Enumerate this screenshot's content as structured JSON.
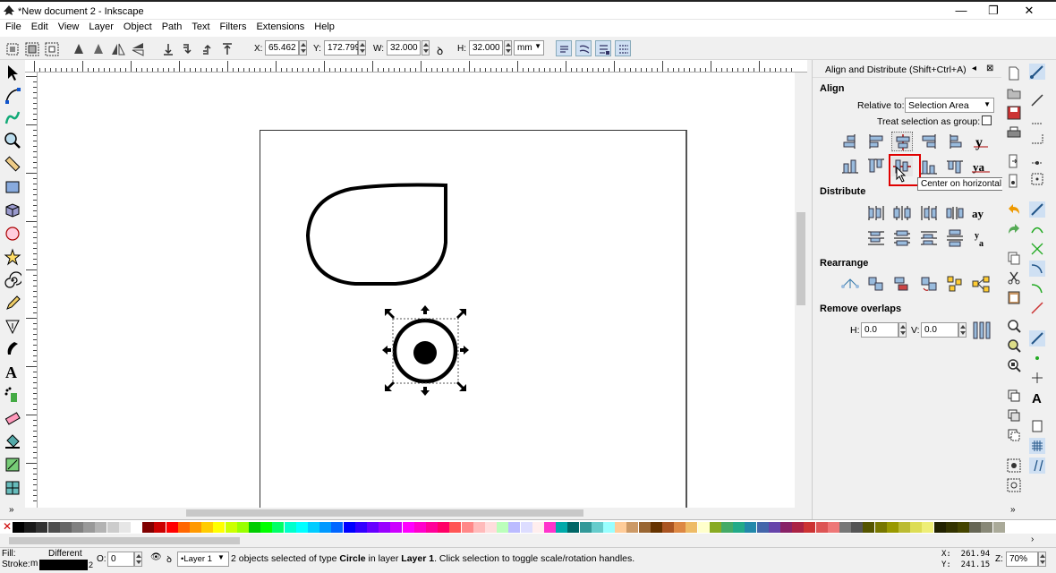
{
  "window": {
    "title": "*New document 2 - Inkscape",
    "min": "—",
    "max": "❐",
    "close": "✕"
  },
  "menu": [
    "File",
    "Edit",
    "View",
    "Layer",
    "Object",
    "Path",
    "Text",
    "Filters",
    "Extensions",
    "Help"
  ],
  "toolbar": {
    "x_label": "X:",
    "x_value": "65.462",
    "y_label": "Y:",
    "y_value": "172.799",
    "w_label": "W:",
    "w_value": "32.000",
    "h_label": "H:",
    "h_value": "32.000",
    "unit": "mm"
  },
  "dialog": {
    "title": "Align and Distribute (Shift+Ctrl+A)",
    "align_heading": "Align",
    "relative_label": "Relative to:",
    "relative_value": "Selection Area",
    "treat_group_label": "Treat selection as group:",
    "distribute_heading": "Distribute",
    "rearrange_heading": "Rearrange",
    "remove_overlaps_heading": "Remove overlaps",
    "h_label": "H:",
    "h_value": "0.0",
    "v_label": "V:",
    "v_value": "0.0",
    "tooltip": "Center on horizontal axis"
  },
  "status": {
    "fill_label": "Fill:",
    "fill_value": "Different",
    "stroke_label": "Stroke:",
    "stroke_value": "m",
    "stroke_width": "2",
    "opacity_label": "O:",
    "opacity_value": "0",
    "layer": "•Layer 1",
    "msg_a": "2 objects selected of type ",
    "msg_b": "Circle",
    "msg_c": " in layer ",
    "msg_d": "Layer 1",
    "msg_e": ". Click selection to toggle scale/rotation handles.",
    "cursor_x": "X:  261.94",
    "cursor_y": "Y:  241.15",
    "zoom_label": "Z:",
    "zoom_value": "70%"
  },
  "palette_more": "»",
  "colors": {
    "accent_selected": "#cfe0f3",
    "highlight_box": "#e00000"
  }
}
